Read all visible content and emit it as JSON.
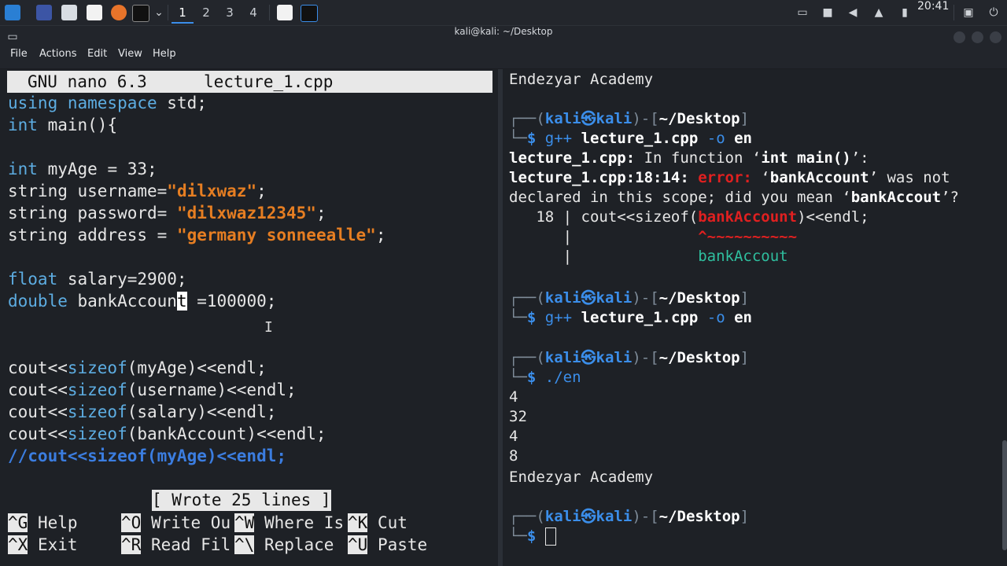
{
  "panel": {
    "workspaces": [
      "1",
      "2",
      "3",
      "4"
    ],
    "clock": "20:41"
  },
  "window": {
    "title": "kali@kali: ~/Desktop",
    "menu": [
      "File",
      "Actions",
      "Edit",
      "View",
      "Help"
    ]
  },
  "nano": {
    "version": "GNU nano 6.3",
    "filename": "lecture_1.cpp",
    "status": "[ Wrote 25 lines ]",
    "shortcuts": [
      {
        "key": "^G",
        "label": "Help"
      },
      {
        "key": "^O",
        "label": "Write Ou"
      },
      {
        "key": "^W",
        "label": "Where Is"
      },
      {
        "key": "^K",
        "label": "Cut"
      },
      {
        "key": "^X",
        "label": "Exit"
      },
      {
        "key": "^R",
        "label": "Read Fil"
      },
      {
        "key": "^\\",
        "label": "Replace"
      },
      {
        "key": "^U",
        "label": "Paste"
      }
    ],
    "code": {
      "l1_a": "using namespace",
      "l1_b": " std;",
      "l2_a": "int",
      "l2_b": " main(){",
      "l3_a": "int",
      "l3_b": " myAge = 33;",
      "l4_a": "string username=",
      "l4_b": "\"dilxwaz\"",
      "l4_c": ";",
      "l5_a": "string password= ",
      "l5_b": "\"dilxwaz12345\"",
      "l5_c": ";",
      "l6_a": "string address = ",
      "l6_b": "\"germany sonneealle\"",
      "l6_c": ";",
      "l7_a": "float",
      "l7_b": " salary=2900;",
      "l8_a": "double",
      "l8_b": " bankAccoun",
      "l8_c": "t",
      "l8_d": " =100000;",
      "c1_a": "cout<<",
      "c1_b": "sizeof",
      "c1_c": "(myAge)<<endl;",
      "c2_a": "cout<<",
      "c2_b": "sizeof",
      "c2_c": "(username)<<endl;",
      "c3_a": "cout<<",
      "c3_b": "sizeof",
      "c3_c": "(salary)<<endl;",
      "c4_a": "cout<<",
      "c4_b": "sizeof",
      "c4_c": "(bankAccount)<<endl;",
      "comment": "//cout<<sizeof(myAge)<<endl;"
    }
  },
  "terminal": {
    "banner": "Endezyar Academy",
    "prompt_user": "kali",
    "prompt_at": "㉿",
    "prompt_host": "kali",
    "prompt_path": "~/Desktop",
    "prompt_dollar": "$",
    "cmd1": {
      "prog": "g++",
      "file": "lecture_1.cpp",
      "flag": "-o",
      "out": "en"
    },
    "err_line1_a": "lecture_1.cpp:",
    "err_line1_b": " In function ",
    "err_line1_c": "‘",
    "err_line1_d": "int main()",
    "err_line1_e": "’:",
    "err_line2_a": "lecture_1.cpp:18:14:",
    "err_line2_b": " error:",
    "err_line2_c": " ‘",
    "err_line2_d": "bankAccount",
    "err_line2_e": "’ was not",
    "err_line3_a": "declared in this scope; did you mean ‘",
    "err_line3_b": "bankAccout",
    "err_line3_c": "’?",
    "err_line4_a": "   18 | cout<<sizeof(",
    "err_line4_b": "bankAccount",
    "err_line4_c": ")<<endl;",
    "err_line5": "      |              ",
    "err_line5_b": "^~~~~~~~~~~",
    "err_line6": "      |              ",
    "err_line6_b": "bankAccout",
    "cmd3": "./en",
    "outputs": [
      "4",
      "32",
      "4",
      "8"
    ],
    "banner2": "Endezyar Academy"
  }
}
